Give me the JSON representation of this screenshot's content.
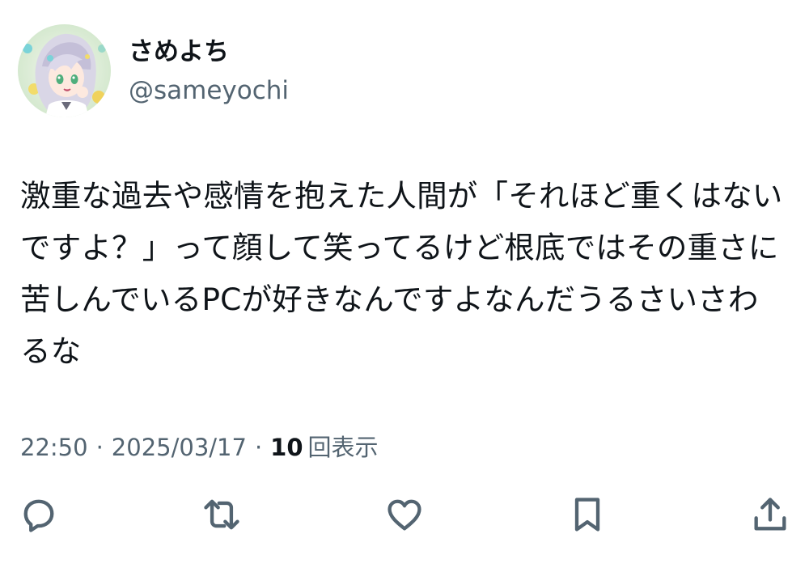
{
  "user": {
    "display_name": "さめよち",
    "handle": "@sameyochi",
    "avatar": "anime-character-avatar"
  },
  "tweet": {
    "text": "激重な過去や感情を抱えた人間が「それほど重くはないですよ？」って顔して笑ってるけど根底ではその重さに苦しんでいるPCが好きなんですよなんだうるさいさわるな"
  },
  "meta": {
    "time": "22:50",
    "separator": "·",
    "date": "2025/03/17",
    "views_count": "10",
    "views_label": "回表示"
  },
  "actions": [
    {
      "name": "reply",
      "icon": "reply-icon"
    },
    {
      "name": "retweet",
      "icon": "retweet-icon"
    },
    {
      "name": "like",
      "icon": "heart-icon"
    },
    {
      "name": "bookmark",
      "icon": "bookmark-icon"
    },
    {
      "name": "share",
      "icon": "share-icon"
    }
  ],
  "colors": {
    "text_primary": "#0f1419",
    "text_secondary": "#536471",
    "icon": "#536471"
  }
}
